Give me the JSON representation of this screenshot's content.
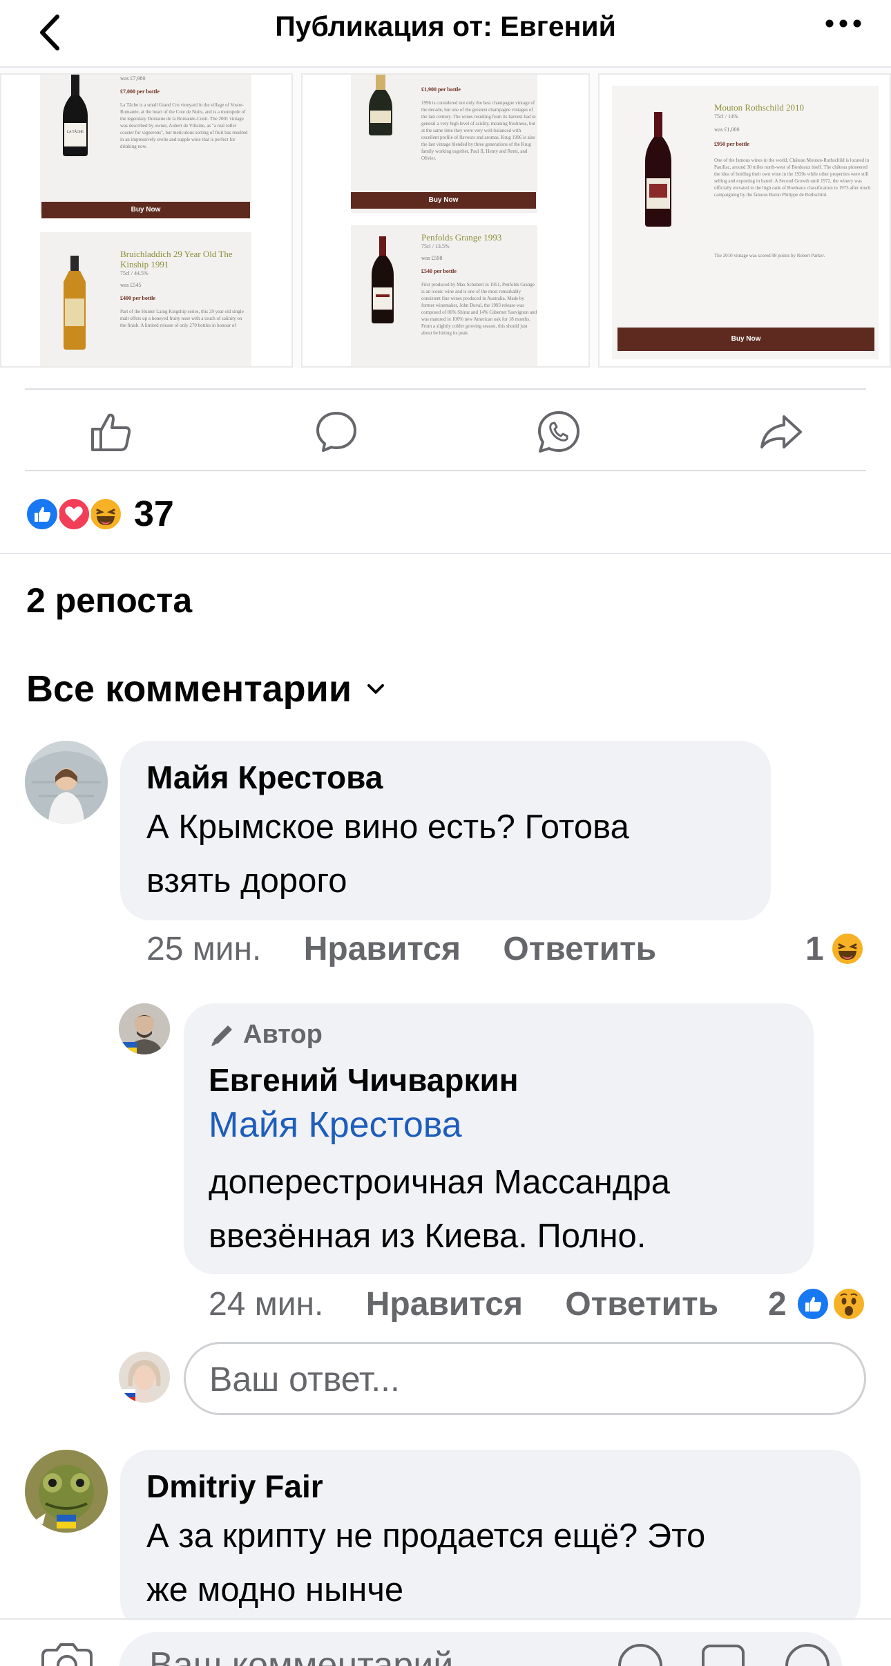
{
  "header": {
    "title": "Публикация от: Евгений"
  },
  "catalog": {
    "col1": [
      {
        "meta": "was £7,980",
        "price": "£7,000 per bottle",
        "desc": "La Tâche is a small Grand Cru vineyard in the village of Vosne-Romanée, at the heart of the Cote de Nuits, and is a monopole of the legendary Domaine de la Romanée-Conti. The 2001 vintage was described by owner, Aubert de Villaine, as \"a real roller coaster for vignerons\", but meticulous sorting of fruit has resulted in an impressively svelte and supple wine that is perfect for drinking now.",
        "buy": "Buy Now"
      },
      {
        "name": "Bruichladdich 29 Year Old The Kinship 1991",
        "meta": "75cl / 44.5%",
        "was": "was £545",
        "price": "£400 per bottle",
        "desc": "Part of the Hunter Laing Kingship series, this 29 year old single malt offers up a honeyed fruity nose with a touch of salinity on the finish. A limited release of only 270 bottles in honour of"
      }
    ],
    "col2": [
      {
        "price": "£1,900 per bottle",
        "desc": "1996 is considered not only the best champagne vintage of the decade, but one of the greatest champagne vintages of the last century. The wines resulting from its harvest had in general a very high level of acidity, meaning freshness, but at the same time they were very well-balanced with excellent profile of flavours and aromas. Krug 1996 is also the last vintage blended by three generations of the Krug family working together. Paul II, Henry and Remi, and Olivier.",
        "buy": "Buy Now"
      },
      {
        "name": "Penfolds Grange 1993",
        "meta": "75cl / 13.5%",
        "was": "was £598",
        "price": "£540 per bottle",
        "desc": "First produced by Max Schubert in 1951, Penfolds Grange is an iconic wine and is one of the most remarkably consistent fine wines produced in Australia. Made by former winemaker, John Duval, the 1993 release was composed of 86% Shiraz and 14% Cabernet Sauvignon and was matured in 100% new American oak for 18 months. From a slightly colder growing season, this should just about be hitting its peak"
      }
    ],
    "col3": [
      {
        "name": "Mouton Rothschild 2010",
        "meta": "75cl / 14%",
        "was": "was £1,000",
        "price": "£950 per bottle",
        "desc": "One of the famous wines in the world, Château Mouton-Rothschild is located in Pauillac, around 30 miles north-west of Bordeaux itself. The château pioneered the idea of bottling their own wine in the 1920s while other properties were still selling and exporting in barrel. A Second Growth until 1972, the winery was officially elevated to the high rank of Bordeaux classification in 1973 after much campaigning by the famous Baron Philippe de Rothschild.",
        "desc2": "The 2010 vintage was scored 98 points by Robert Parker.",
        "buy": "Buy Now"
      }
    ],
    "bottle_labels": {
      "tache": "LA TÂCHE"
    }
  },
  "reactions": {
    "count": "37",
    "icons": [
      "like-icon",
      "love-icon",
      "haha-icon"
    ],
    "colors": {
      "like": "#1877f2",
      "love": "#f33e58",
      "haha": "#f7b125"
    }
  },
  "reposts": "2 репоста",
  "comments_filter": "Все комментарии",
  "comments": [
    {
      "author": "Майя Крестова",
      "text_line1": "А Крымское вино есть? Готова",
      "text_line2": "взять дорого",
      "time": "25 мин.",
      "like": "Нравится",
      "reply": "Ответить",
      "reaction_count": "1"
    },
    {
      "tag": "Автор",
      "author": "Евгений Чичваркин",
      "mention": "Майя Крестова",
      "text_line1": "доперестроичная Массандра",
      "text_line2": "ввезённая из Киева.  Полно.",
      "time": "24 мин.",
      "like": "Нравится",
      "reply": "Ответить",
      "reaction_count": "2"
    },
    {
      "author": "Dmitriy Fair",
      "text_line1": "А за крипту не продается ещё? Это",
      "text_line2": "же модно нынче"
    }
  ],
  "reply_placeholder": "Ваш ответ...",
  "comment_placeholder": "Ваш комментарий..."
}
